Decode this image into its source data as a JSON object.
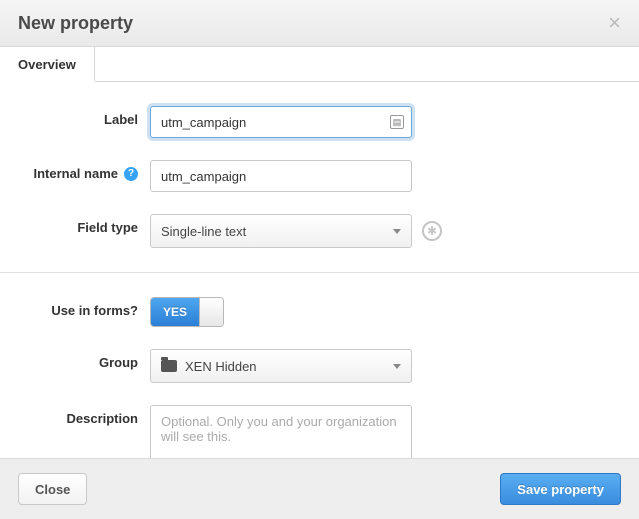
{
  "header": {
    "title": "New property"
  },
  "tabs": [
    {
      "label": "Overview"
    }
  ],
  "form": {
    "label_field": {
      "label": "Label",
      "value": "utm_campaign"
    },
    "internal_name": {
      "label": "Internal name",
      "value": "utm_campaign"
    },
    "field_type": {
      "label": "Field type",
      "value": "Single-line text"
    },
    "use_in_forms": {
      "label": "Use in forms?",
      "value": "YES"
    },
    "group": {
      "label": "Group",
      "value": "XEN Hidden"
    },
    "description": {
      "label": "Description",
      "placeholder": "Optional. Only you and your organization will see this."
    }
  },
  "footer": {
    "close_label": "Close",
    "save_label": "Save property"
  }
}
